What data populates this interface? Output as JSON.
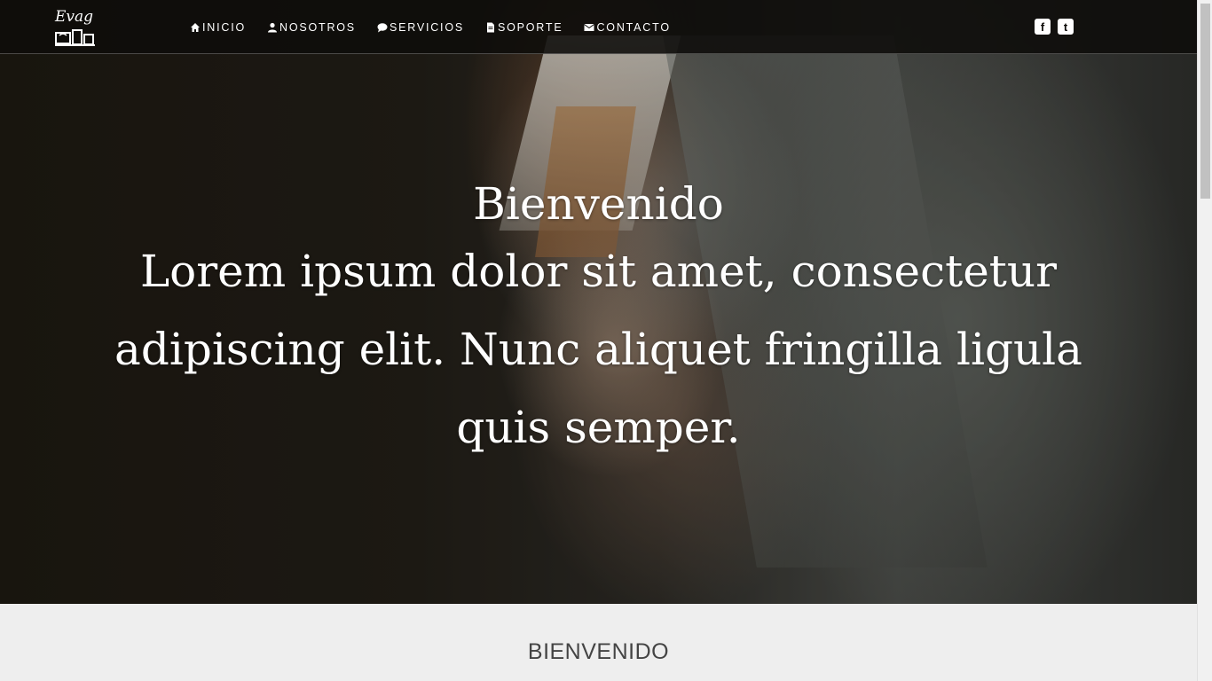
{
  "brand": {
    "logo_text": "Evag"
  },
  "nav": {
    "items": [
      {
        "label": "INICIO",
        "icon": "home-icon"
      },
      {
        "label": "NOSOTROS",
        "icon": "user-icon"
      },
      {
        "label": "SERVICIOS",
        "icon": "comment-icon"
      },
      {
        "label": "SOPORTE",
        "icon": "file-icon"
      },
      {
        "label": "CONTACTO",
        "icon": "envelope-icon"
      }
    ]
  },
  "social": {
    "facebook": "f",
    "twitter": "t"
  },
  "hero": {
    "title": "Bienvenido",
    "body": "Lorem ipsum dolor sit amet, consectetur adipiscing elit. Nunc aliquet fringilla ligula quis semper."
  },
  "section": {
    "title": "BIENVENIDO",
    "body": ""
  },
  "colors": {
    "navbar_bg": "#0e0c0a",
    "section_bg": "#eeeeee",
    "text_light": "#ffffff"
  }
}
